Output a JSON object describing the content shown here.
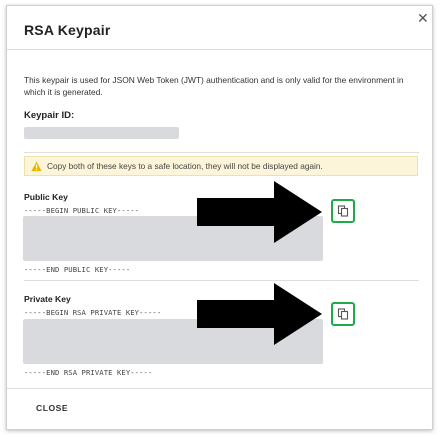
{
  "dialog": {
    "title": "RSA Keypair",
    "close_icon": "close-icon",
    "description": "This keypair is used for JSON Web Token (JWT) authentication and is only valid for the environment in which it is generated.",
    "keypair_id_label": "Keypair ID:",
    "warning": {
      "icon": "warning-triangle-icon",
      "text": "Copy both of these keys to a safe location, they will not be displayed again.",
      "icon_color": "#f0b400"
    },
    "public_key": {
      "label": "Public Key",
      "begin": "-----BEGIN PUBLIC KEY-----",
      "end": "-----END PUBLIC KEY-----",
      "copy_icon": "copy-icon"
    },
    "private_key": {
      "label": "Private Key",
      "begin": "-----BEGIN RSA PRIVATE KEY-----",
      "end": "-----END RSA PRIVATE KEY-----",
      "copy_icon": "copy-icon"
    },
    "footer": {
      "close_label": "CLOSE"
    }
  },
  "colors": {
    "highlight": "#1faa4b",
    "redaction": "#d8dade",
    "warning_bg": "#fcf5d9",
    "annotation_arrow": "#000000"
  }
}
